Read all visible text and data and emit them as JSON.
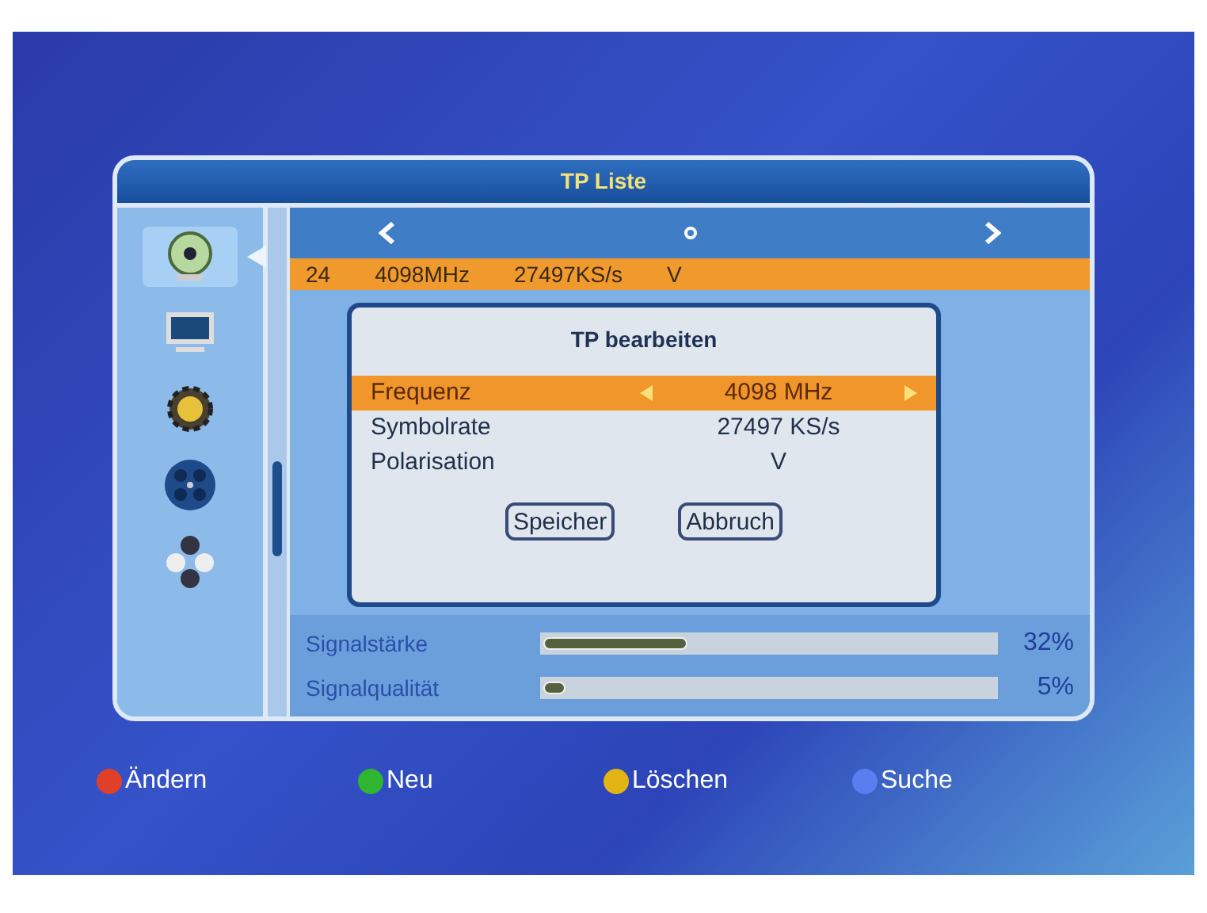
{
  "window": {
    "title": "TP Liste"
  },
  "sidebar": {
    "items": [
      {
        "selected": true
      },
      {
        "selected": false
      },
      {
        "selected": false
      },
      {
        "selected": false
      },
      {
        "selected": false
      }
    ]
  },
  "transponder_row": {
    "selected": true,
    "cells": [
      "24",
      "4098MHz",
      "27497KS/s",
      "V"
    ]
  },
  "dialog": {
    "title": "TP bearbeiten",
    "fields": [
      {
        "label": "Frequenz",
        "value": "4098 MHz",
        "selected": true
      },
      {
        "label": "Symbolrate",
        "value": "27497 KS/s",
        "selected": false
      },
      {
        "label": "Polarisation",
        "value": "V",
        "selected": false
      }
    ],
    "buttons": [
      "Speicher",
      "Abbruch"
    ]
  },
  "signals": [
    {
      "label": "Signalstärke",
      "level": 0.32,
      "reading": "32%"
    },
    {
      "label": "Signalqualität",
      "level": 0.05,
      "reading": "5%"
    }
  ],
  "legend": [
    {
      "label": "Ändern",
      "color": "#e0402a"
    },
    {
      "label": "Neu",
      "color": "#2fb52f"
    },
    {
      "label": "Löschen",
      "color": "#e2b514"
    },
    {
      "label": "Suche",
      "color": "#5a7ef0"
    }
  ]
}
